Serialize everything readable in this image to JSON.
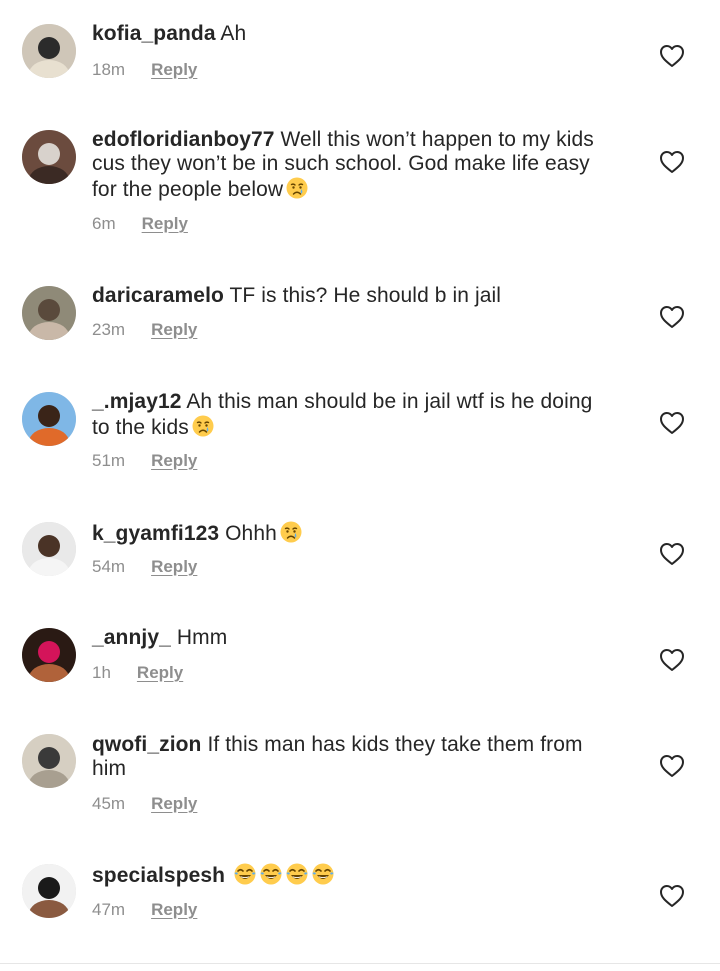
{
  "comments": [
    {
      "username": "kofia_panda",
      "text": "Ah",
      "emoji": [],
      "time": "18m",
      "reply": "Reply",
      "avatar_colors": [
        "#cfc6b8",
        "#2b2b2b",
        "#e8e0d0"
      ]
    },
    {
      "username": "edofloridianboy77",
      "text": "Well this won’t happen to my kids cus they won’t be in such school. God make life easy for the people below",
      "emoji": [
        "crying-face"
      ],
      "time": "6m",
      "reply": "Reply",
      "avatar_colors": [
        "#6b4b3e",
        "#d8d2cc",
        "#3b2a24"
      ]
    },
    {
      "username": "daricaramelo",
      "text": "TF is this? He should b in jail",
      "emoji": [],
      "time": "23m",
      "reply": "Reply",
      "avatar_colors": [
        "#8f8a78",
        "#5a4a3c",
        "#c9b8a8"
      ]
    },
    {
      "username": "_.mjay12",
      "text": "Ah this man should be in jail wtf is he doing to the kids",
      "emoji": [
        "crying-face"
      ],
      "time": "51m",
      "reply": "Reply",
      "avatar_colors": [
        "#7fb7e6",
        "#3a2418",
        "#e06a2a"
      ]
    },
    {
      "username": "k_gyamfi123",
      "text": "Ohhh",
      "emoji": [
        "crying-face"
      ],
      "time": "54m",
      "reply": "Reply",
      "avatar_colors": [
        "#e9e9e9",
        "#4a3326",
        "#f5f5f5"
      ]
    },
    {
      "username": "_annjy_",
      "text": "Hmm",
      "emoji": [],
      "time": "1h",
      "reply": "Reply",
      "avatar_colors": [
        "#2a1a14",
        "#d4145a",
        "#b0623a"
      ]
    },
    {
      "username": "qwofi_zion",
      "text": "If this man has kids they take them from him",
      "emoji": [],
      "time": "45m",
      "reply": "Reply",
      "avatar_colors": [
        "#d6cfc2",
        "#3a3a3a",
        "#a89f90"
      ]
    },
    {
      "username": "specialspesh",
      "text": "",
      "emoji": [
        "tears-of-joy",
        "tears-of-joy",
        "tears-of-joy",
        "tears-of-joy"
      ],
      "time": "47m",
      "reply": "Reply",
      "avatar_colors": [
        "#f2f2f2",
        "#1a1a1a",
        "#8a5a40"
      ]
    }
  ],
  "colors": {
    "text": "#262626",
    "meta": "#8e8e8e",
    "heart_stroke": "#262626"
  },
  "icons": {
    "like": "heart-outline-icon",
    "crying": "crying-face-emoji",
    "laughing": "tears-of-joy-emoji"
  }
}
